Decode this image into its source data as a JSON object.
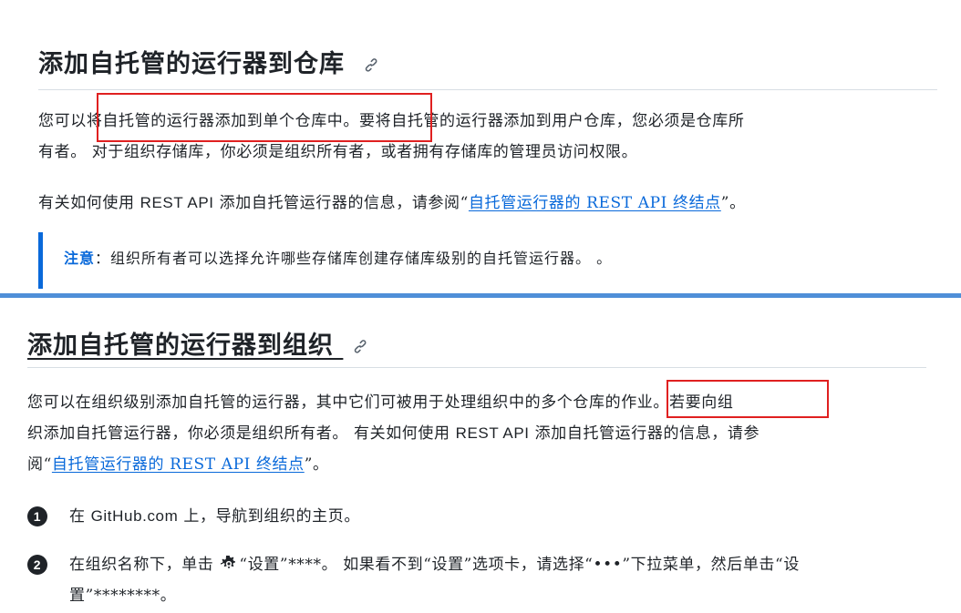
{
  "section_repo": {
    "title": "添加自托管的运行器到仓库",
    "para1_line1_a": "您可以",
    "para1_line1_b": "将自托管的运行器添加到单个仓库中。",
    "para1_line1_c": "要将自托管的运行器添加到用户仓库，您必须是仓库所",
    "para1_line2": "有者。 对于组织存储库，你必须是组织所有者，或者拥有存储库的管理员访问权限。",
    "para2_a": "有关如何使用 ",
    "para2_b": "REST API",
    "para2_c": " 添加自托管运行器的信息，请参阅“",
    "para2_link": "自托管运行器的 REST API 终结点",
    "para2_d": "”。",
    "note_label": "注意",
    "note_text": "：组织所有者可以选择允许哪些存储库创建存储库级别的自托管运行器。 。"
  },
  "section_org": {
    "title": "添加自托管的运行器到组织",
    "para_line1_a": "您可以在组织级别添加自托管的运行器，其中它们可被用于处理组织中的",
    "para_line1_b": "多个仓库的作业。",
    "para_line1_c": "若要向组",
    "para_line2_a": "织添加自托管运行器，你必须是组织所有者。 有关如何使用 ",
    "para_line2_b": "REST API",
    "para_line2_c": " 添加自托管运行器的信息，请参",
    "para_line3_a": "阅“",
    "para_line3_link": "自托管运行器的 REST API 终结点",
    "para_line3_b": "”。",
    "steps": [
      {
        "number": "1",
        "a": "在 ",
        "b": "GitHub.com",
        "c": " 上，导航到组织的主页。"
      },
      {
        "number": "2",
        "line1_a": "在组织名称下，单击 ",
        "line1_b": "“设置”****。 如果看不到“设置”选项卡，请选择“•••”下拉菜单，然后单击“设",
        "line2": "置”********。"
      }
    ]
  },
  "colors": {
    "link": "#0969da",
    "highlight_box": "#e02020",
    "note_bar": "#0969da",
    "divider": "#4f8fd8"
  },
  "icons": [
    "link-icon",
    "gear-icon"
  ]
}
